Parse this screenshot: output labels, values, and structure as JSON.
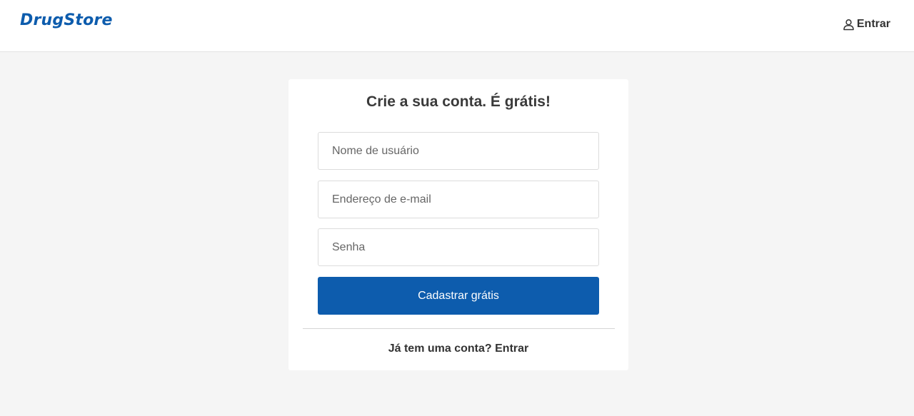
{
  "header": {
    "logo": "DrugStore",
    "login_label": "Entrar",
    "login_icon": "user-icon"
  },
  "signup": {
    "title": "Crie a sua conta. É grátis!",
    "username_placeholder": "Nome de usuário",
    "email_placeholder": "Endereço de e-mail",
    "password_placeholder": "Senha",
    "submit_label": "Cadastrar grátis",
    "have_account_text": "Já tem uma conta?",
    "login_link": "Entrar"
  },
  "colors": {
    "brand": "#0d5cad",
    "background": "#f5f5f5",
    "card": "#ffffff"
  }
}
